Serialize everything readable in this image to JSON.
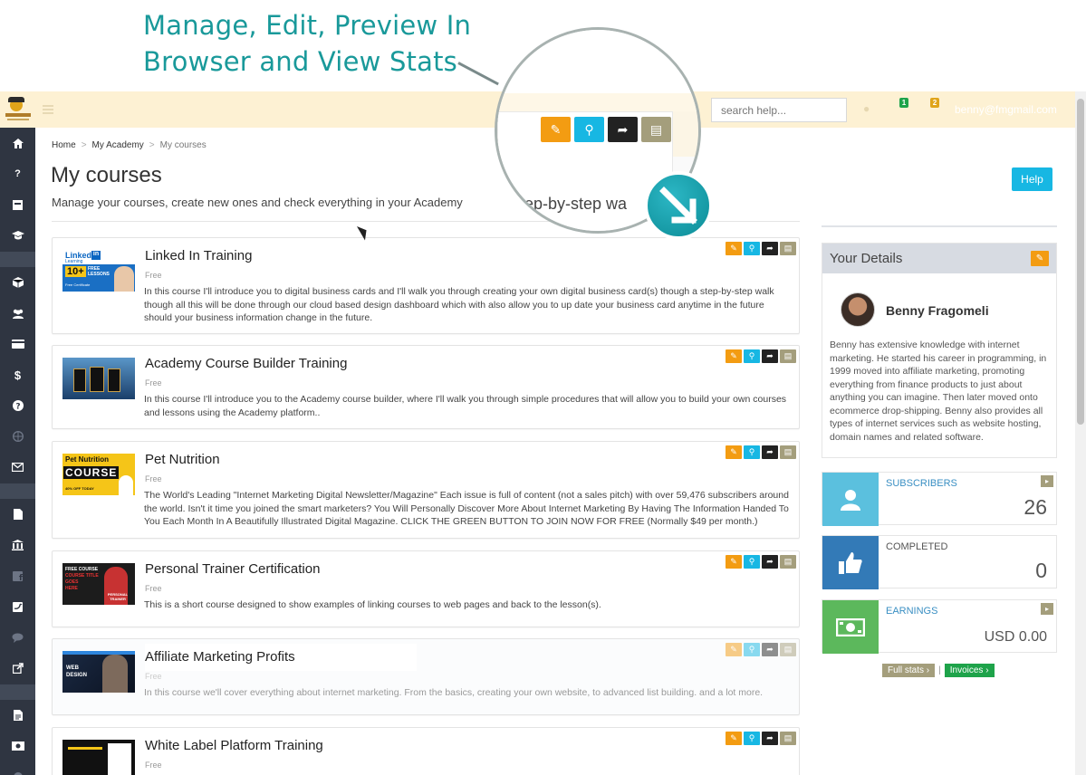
{
  "promo": {
    "line1": "Manage, Edit, Preview In",
    "line2": "Browser and View Stats"
  },
  "topbar": {
    "search_placeholder": "search help...",
    "badge_1": "1",
    "badge_2": "2",
    "email": "benny@fmgmail.com"
  },
  "breadcrumb": {
    "home": "Home",
    "academy": "My Academy",
    "current": "My courses"
  },
  "page": {
    "title": "My courses",
    "subtitle": "Manage your courses, create new ones and check everything in your Academy",
    "help": "Help"
  },
  "magnifier": {
    "text": "ep-by-step wa"
  },
  "courses": [
    {
      "title": "Linked In Training",
      "price": "Free",
      "description": "In this course I'll introduce you to digital business cards and I'll walk you through creating your own digital business card(s) though a step-by-step walk though all this will be done through our cloud based design dashboard which with also allow you to up date your business card anytime in the future should your business information change in the future."
    },
    {
      "title": "Academy Course Builder Training",
      "price": "Free",
      "description": "In this course I'll introduce you to the Academy course builder, where I'll walk you through simple procedures that will allow you to build your own courses and lessons using the Academy platform.."
    },
    {
      "title": "Pet Nutrition",
      "price": "Free",
      "description": "The World's Leading \"Internet Marketing Digital Newsletter/Magazine\" Each issue is full of content (not a sales pitch) with over 59,476 subscribers around the world. Isn't it time you joined the smart marketers? You Will Personally Discover More About Internet Marketing By Having The Information Handed To You Each Month In A Beautifully Illustrated Digital Magazine. CLICK THE GREEN BUTTON TO JOIN NOW FOR FREE (Normally $49 per month.)"
    },
    {
      "title": "Personal Trainer Certification",
      "price": "Free",
      "description": "This is a short course designed to show examples of linking courses to web pages and back to the lesson(s)."
    },
    {
      "title": "Affiliate Marketing Profits",
      "price": "Free",
      "description": "In this course we'll cover everything about internet marketing. From the basics, creating your own website, to advanced list building. and a lot more."
    },
    {
      "title": "White Label Platform Training",
      "price": "Free",
      "description": ""
    }
  ],
  "thumbs": {
    "linkedin_brand": "Linked",
    "linkedin_in": "in",
    "linkedin_sub": "Learning",
    "linkedin_big": "10+",
    "linkedin_free": "FREE",
    "linkedin_lessons": "LESSONS",
    "linkedin_cert": "Free Certificate",
    "pet_top": "Pet Nutrition",
    "pet_course": "COURSE",
    "pet_off": "40% OFF TODAY",
    "trainer_l1": "FREE COURSE",
    "trainer_l2": "COURSE TITLE",
    "trainer_l3": "GOES",
    "trainer_l4": "HERE",
    "trainer_tag": "PERSONAL TRAINER",
    "web_l1": "WEB",
    "web_l2": "DESIGN"
  },
  "details": {
    "title": "Your Details",
    "name": "Benny Fragomeli",
    "bio": "Benny has extensive knowledge with internet marketing. He started his career in programming, in 1999 moved into affiliate marketing, promoting everything from finance products to just about anything you can imagine. Then later moved onto ecommerce drop-shipping. Benny also provides all types of internet services such as website hosting, domain names and related software."
  },
  "stats": {
    "subscribers_label": "SUBSCRIBERS",
    "subscribers_value": "26",
    "completed_label": "COMPLETED",
    "completed_value": "0",
    "earnings_label": "EARNINGS",
    "earnings_value": "USD 0.00",
    "full_stats": "Full stats",
    "separator": "|",
    "invoices": "Invoices"
  },
  "colors": {
    "accent_teal": "#19999a",
    "topbar": "#fdf1d3",
    "sidebar": "#2f3541",
    "edit": "#f39c12",
    "view": "#17b7e3",
    "share": "#222222",
    "stats": "#a49e7c",
    "subscribers": "#5bc0de",
    "completed": "#337ab7",
    "earnings": "#5cb85c"
  }
}
